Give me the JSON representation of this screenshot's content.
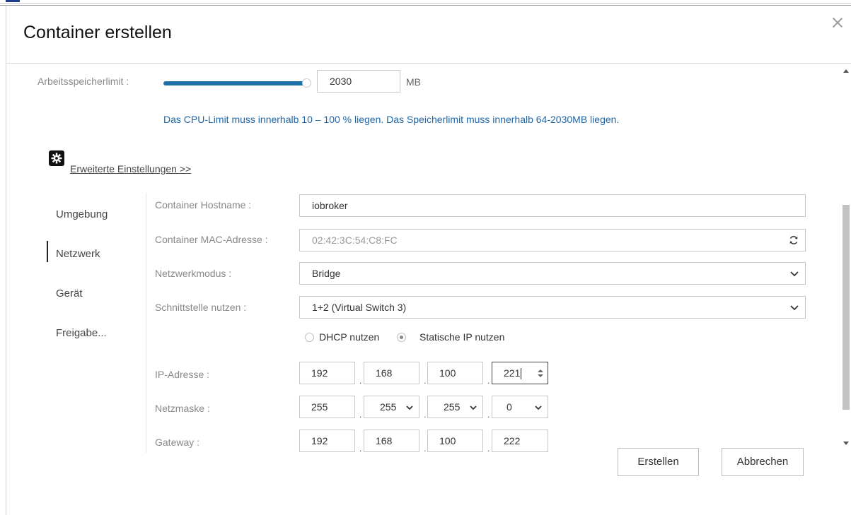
{
  "dialog": {
    "title": "Container erstellen"
  },
  "memory": {
    "label": "Arbeitsspeicherlimit :",
    "value": "2030",
    "unit": "MB",
    "slider_fraction": 1.0
  },
  "hint": "Das CPU-Limit muss innerhalb 10 – 100 % liegen. Das Speicherlimit muss innerhalb 64-2030MB liegen.",
  "advanced": {
    "icon": "gear-icon",
    "link": "Erweiterte Einstellungen >>"
  },
  "nav": {
    "items": [
      {
        "label": "Umgebung"
      },
      {
        "label": "Netzwerk"
      },
      {
        "label": "Gerät"
      },
      {
        "label": "Freigabe..."
      }
    ],
    "active": "Netzwerk"
  },
  "network": {
    "hostname_label": "Container Hostname :",
    "hostname_value": "iobroker",
    "mac_label": "Container MAC-Adresse :",
    "mac_value": "02:42:3C:54:C8:FC",
    "mode_label": "Netzwerkmodus :",
    "mode_value": "Bridge",
    "iface_label": "Schnittstelle nutzen :",
    "iface_value": "1+2 (Virtual Switch 3)",
    "dhcp_label": "DHCP nutzen",
    "static_label": "Statische IP nutzen",
    "selected_mode": "static",
    "ip_label": "IP-Adresse :",
    "ip": [
      "192",
      "168",
      "100",
      "221"
    ],
    "netmask_label": "Netzmaske :",
    "netmask": [
      "255",
      "255",
      "255",
      "0"
    ],
    "gateway_label": "Gateway :",
    "gateway": [
      "192",
      "168",
      "100",
      "222"
    ]
  },
  "footer": {
    "create": "Erstellen",
    "cancel": "Abbrechen"
  }
}
